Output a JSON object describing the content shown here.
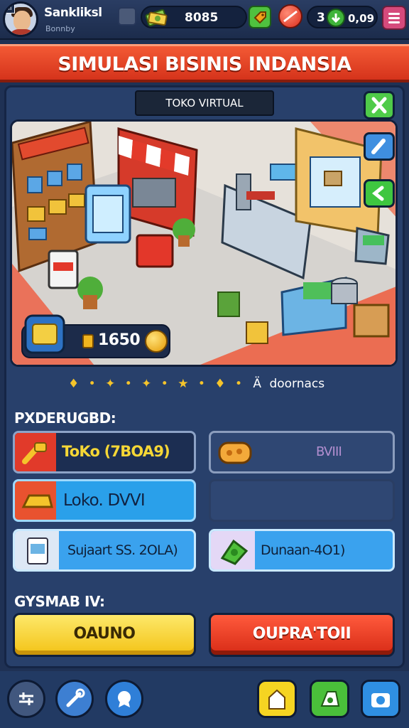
{
  "player": {
    "name": "Sankliksl",
    "subtitle": "Bonnby",
    "avatar_badge": "ii"
  },
  "resources": {
    "cash": "8085",
    "tickets_left": "3",
    "gems": "0,09"
  },
  "banner": {
    "title": "SIMULASI BISINIS INDANSIA"
  },
  "scene": {
    "tag": "TOKO VIRTUAL",
    "coins": "1650"
  },
  "rating": {
    "prefix": "♦ • ✦ • ✦ • ★ • ♦ •",
    "letter": "Ä",
    "text": "doornacs"
  },
  "sections": {
    "first_label": "PXDERUGBD:",
    "second_label": "GYSMAB IV:"
  },
  "items": {
    "a_label": "ToKo (7BOA9)",
    "b_label": "BVIII",
    "c_label": "Loko. DVVI",
    "e_label": "Sujaart SS. 2OLA)",
    "f_label": "Dunaan-4O1)"
  },
  "buttons": {
    "yellow_label": "OAUNO",
    "red_label": "OUPRA'TOII"
  },
  "colors": {
    "banner": "#e2441f",
    "panel": "#28406b",
    "accent_green": "#4fc13f",
    "accent_yellow": "#f5d422",
    "accent_blue": "#2f8fe2"
  }
}
